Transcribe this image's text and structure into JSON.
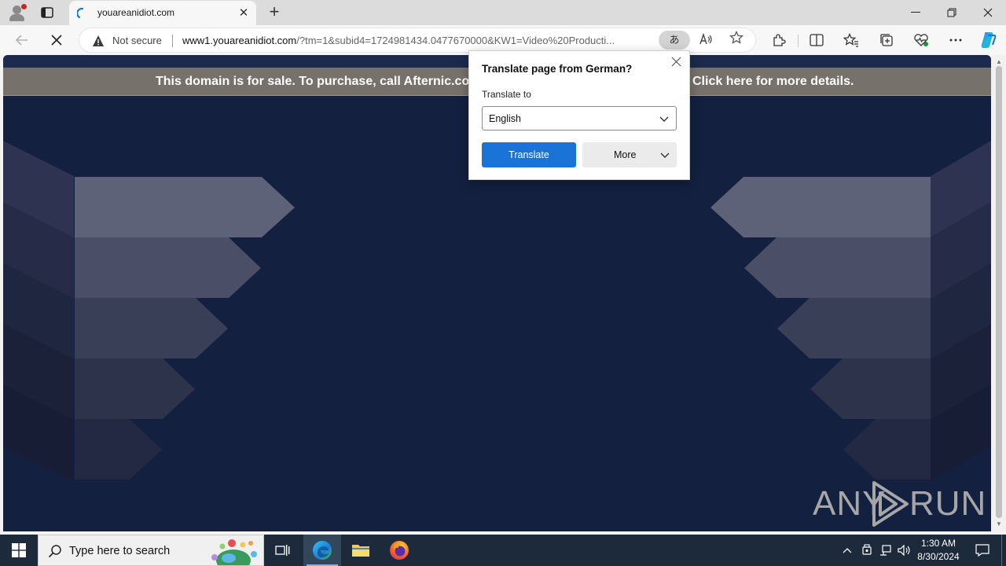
{
  "browser": {
    "tab": {
      "title": "youareanidiot.com"
    },
    "address": {
      "security_label": "Not secure",
      "url_host": "www1.youareanidiot.com",
      "url_rest": "/?tm=1&subid4=1724981434.0477670000&KW1=Video%20Producti..."
    },
    "translate_button_label": "あ"
  },
  "page": {
    "banner_text": "This domain is for sale. To purchase, call Afternic.cor",
    "banner_link": "Click here for more details.",
    "watermark": {
      "left": "ANY",
      "right": "RUN"
    }
  },
  "translate_popup": {
    "title": "Translate page from German?",
    "translate_to_label": "Translate to",
    "selected_language": "English",
    "translate_button": "Translate",
    "more_button": "More"
  },
  "taskbar": {
    "search_placeholder": "Type here to search",
    "time": "1:30 AM",
    "date": "8/30/2024"
  },
  "colors": {
    "page_background": "#13203f",
    "banner": "#77716b",
    "accent": "#1a73d6"
  }
}
